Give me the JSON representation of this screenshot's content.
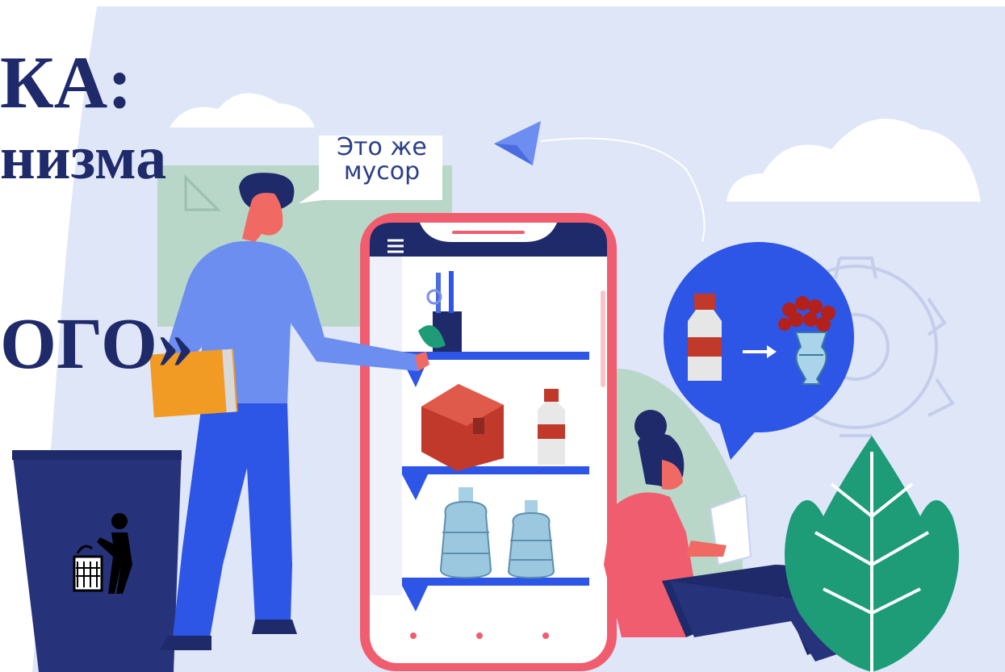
{
  "title": {
    "line1": "КА:",
    "line2": "низма",
    "line3": "ОГО»"
  },
  "speech_bubble": {
    "line1": "Это же",
    "line2": "мусор"
  },
  "icons": [
    "paper-plane-icon",
    "hamburger-menu-icon",
    "recycle-bin-person-icon",
    "gear-icon",
    "leaf-icon"
  ],
  "colors": {
    "background": "#dfe6f8",
    "accent_pink": "#f05d6e",
    "blue": "#2d55e6",
    "navy": "#1f2a6b",
    "bin": "#26337a",
    "green": "#1d9c77"
  }
}
